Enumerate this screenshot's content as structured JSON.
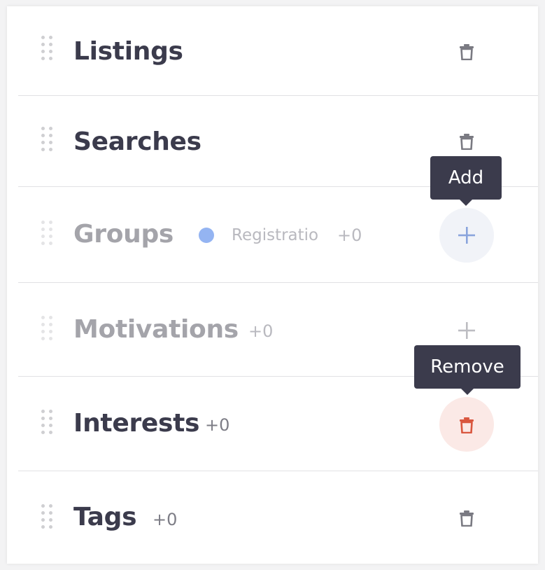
{
  "rows": [
    {
      "title": "Listings",
      "count": "",
      "action": "trash-icon"
    },
    {
      "title": "Searches",
      "count": "",
      "action": "trash-icon"
    },
    {
      "title": "Groups",
      "count": "+0",
      "tag_label": "Registratio",
      "tag_color": "#94b4f2",
      "action": "plus-icon",
      "state": "disabled"
    },
    {
      "title": "Motivations",
      "count": "+0",
      "action": "plus-icon",
      "state": "disabled"
    },
    {
      "title": "Interests",
      "count": "+0",
      "action": "trash-icon"
    },
    {
      "title": "Tags",
      "count": "+0",
      "action": "trash-icon"
    }
  ],
  "tooltips": {
    "add": "Add",
    "remove": "Remove"
  },
  "colors": {
    "text_dark": "#3b3b4c",
    "text_muted": "#a4a4aa",
    "add_accent": "#94b4f2",
    "remove_accent": "#d9573f",
    "tooltip_bg": "#3b3b4c"
  }
}
